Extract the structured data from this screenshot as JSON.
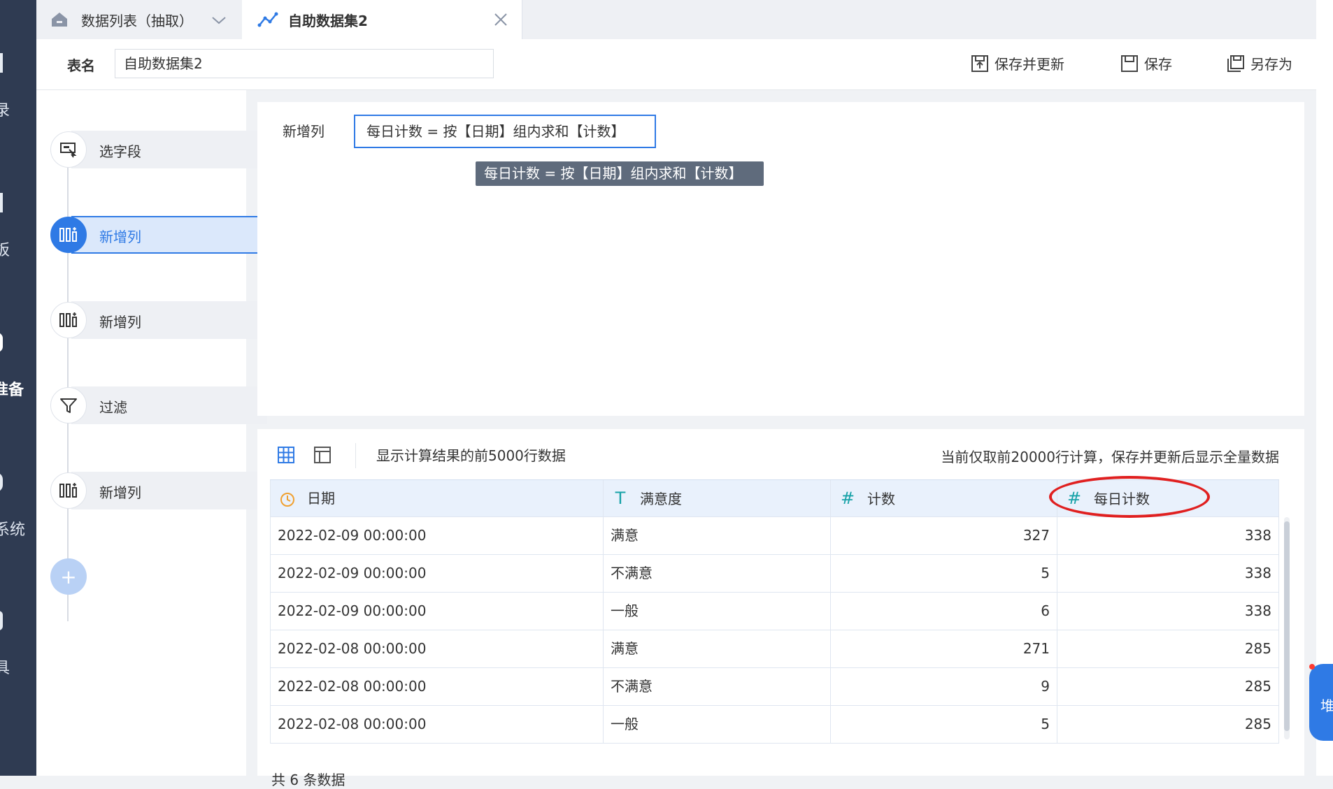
{
  "leftnav": {
    "labels": [
      "录",
      "板",
      "准备",
      "系统",
      "具"
    ]
  },
  "tabs": [
    {
      "label": "数据列表（抽取）"
    },
    {
      "label": "自助数据集2"
    }
  ],
  "header": {
    "table_name_label": "表名",
    "table_name_value": "自助数据集2",
    "save_update": "保存并更新",
    "save": "保存",
    "save_as": "另存为"
  },
  "steps": [
    {
      "label": "选字段",
      "icon": "select-field-icon",
      "active": false
    },
    {
      "label": "新增列",
      "icon": "add-column-icon",
      "active": true
    },
    {
      "label": "新增列",
      "icon": "add-column-icon",
      "active": false
    },
    {
      "label": "过滤",
      "icon": "filter-icon",
      "active": false
    },
    {
      "label": "新增列",
      "icon": "add-column-icon",
      "active": false
    }
  ],
  "add_step_symbol": "+",
  "editor": {
    "label": "新增列",
    "formula": "每日计数 = 按【日期】组内求和【计数】",
    "tooltip": "每日计数 = 按【日期】组内求和【计数】"
  },
  "preview": {
    "left_text": "显示计算结果的前5000行数据",
    "right_text": "当前仅取前20000行计算，保存并更新后显示全量数据",
    "columns": [
      {
        "name": "日期",
        "type_icon": "clock-icon"
      },
      {
        "name": "满意度",
        "type_icon": "T"
      },
      {
        "name": "计数",
        "type_icon": "#"
      },
      {
        "name": "每日计数",
        "type_icon": "#"
      }
    ],
    "rows": [
      [
        "2022-02-09 00:00:00",
        "满意",
        "327",
        "338"
      ],
      [
        "2022-02-09 00:00:00",
        "不满意",
        "5",
        "338"
      ],
      [
        "2022-02-09 00:00:00",
        "一般",
        "6",
        "338"
      ],
      [
        "2022-02-08 00:00:00",
        "满意",
        "271",
        "285"
      ],
      [
        "2022-02-08 00:00:00",
        "不满意",
        "9",
        "285"
      ],
      [
        "2022-02-08 00:00:00",
        "一般",
        "5",
        "285"
      ]
    ],
    "footer": "共 6 条数据"
  },
  "right_float_text": "堆",
  "colors": {
    "accent": "#2f7ae5",
    "nav_bg": "#2f3b52",
    "highlight_circle": "#e02020",
    "type_teal": "#17a2a8",
    "type_orange": "#f0a030"
  }
}
